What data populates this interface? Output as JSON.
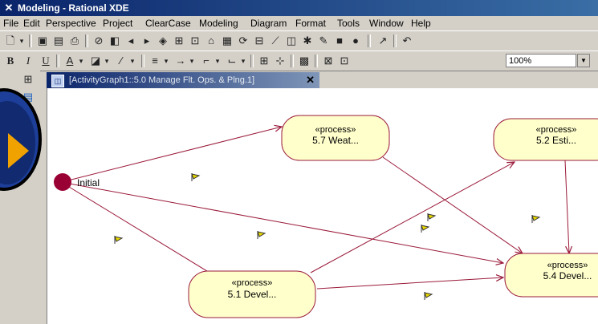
{
  "window": {
    "title": "Modeling - Rational XDE"
  },
  "menu": [
    "File",
    "Edit",
    "Perspective",
    "Project",
    "ClearCase",
    "Modeling",
    "Diagram",
    "Format",
    "Tools",
    "Window",
    "Help"
  ],
  "toolbar2": {
    "zoom_value": "100%"
  },
  "document_tab": {
    "title": "[ActivityGraph1::5.0 Manage Flt. Ops. & Plng.1]",
    "close_label": "✕"
  },
  "diagram": {
    "initial_label": "Initial",
    "states": [
      {
        "stereotype": "«process»",
        "name": "5.7 Weat..."
      },
      {
        "stereotype": "«process»",
        "name": "5.2 Esti..."
      },
      {
        "stereotype": "«process»",
        "name": "5.4 Devel..."
      },
      {
        "stereotype": "«process»",
        "name": "5.1 Devel..."
      }
    ]
  },
  "colors": {
    "state_fill": "#ffffcc",
    "state_border": "#9a1a3a",
    "edge": "#9a1a3a",
    "initial_node": "#990033"
  }
}
